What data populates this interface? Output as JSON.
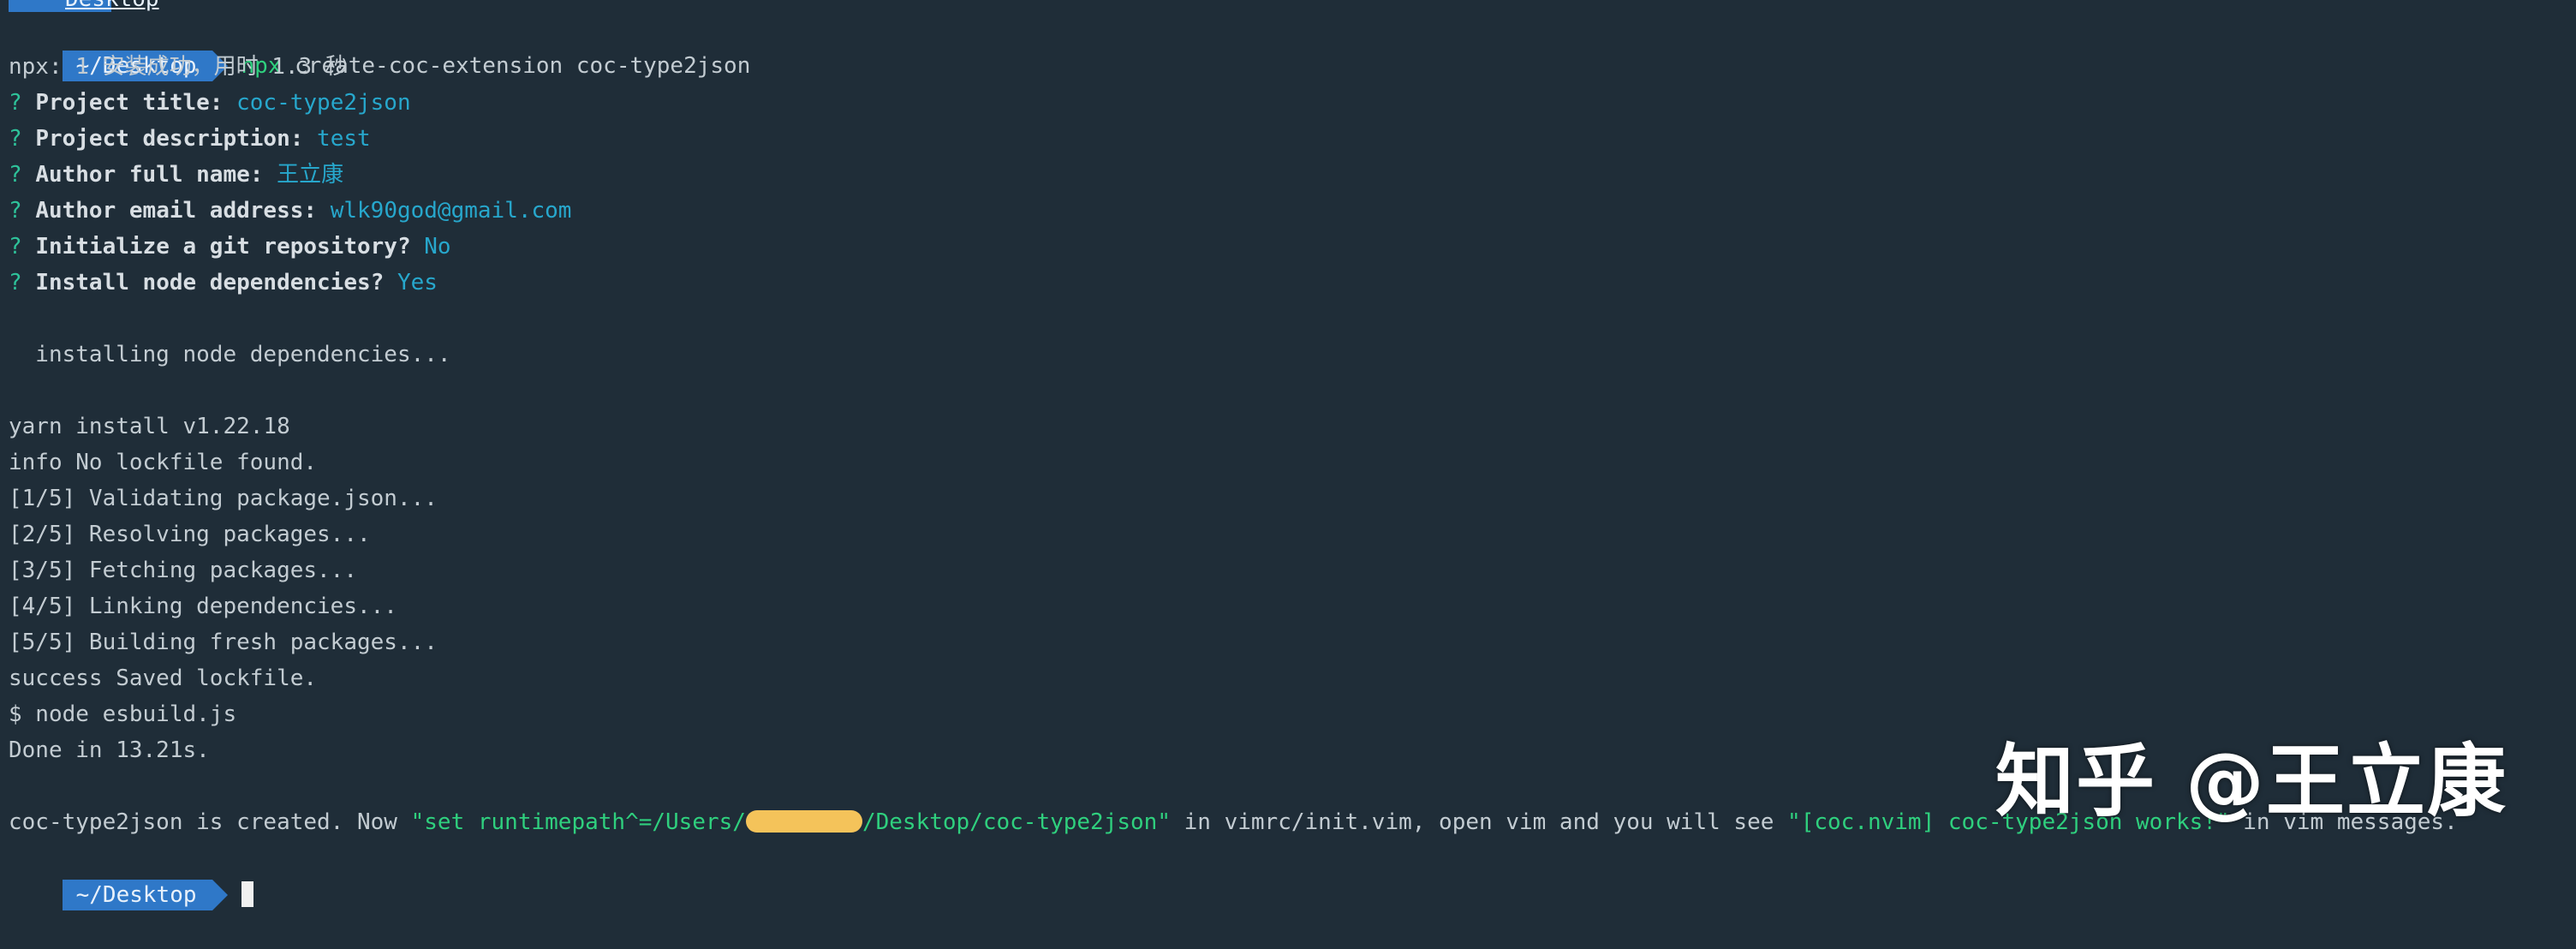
{
  "colors": {
    "background": "#1f2d38",
    "prompt_bg": "#2f78c8",
    "command": "#2fd07e",
    "question_mark": "#2ec29a",
    "answer": "#27a7cc",
    "redaction": "#f4c35a"
  },
  "top_fragment": "Desktop",
  "prompt": {
    "path": "~/Desktop"
  },
  "command": {
    "exe": "npx",
    "args": " create-coc-extension coc-type2json"
  },
  "npx_note": "npx: 1 安装成功，用时 1.3 秒",
  "questions": [
    {
      "mark": "?",
      "label": "Project title:",
      "answer": "coc-type2json"
    },
    {
      "mark": "?",
      "label": "Project description:",
      "answer": "test"
    },
    {
      "mark": "?",
      "label": "Author full name:",
      "answer": "王立康"
    },
    {
      "mark": "?",
      "label": "Author email address:",
      "answer": "wlk90god@gmail.com"
    },
    {
      "mark": "?",
      "label": "Initialize a git repository?",
      "answer": "No"
    },
    {
      "mark": "?",
      "label": "Install node dependencies?",
      "answer": "Yes"
    }
  ],
  "installing": "  installing node dependencies...",
  "yarn": [
    "yarn install v1.22.18",
    "info No lockfile found.",
    "[1/5] Validating package.json...",
    "[2/5] Resolving packages...",
    "[3/5] Fetching packages...",
    "[4/5] Linking dependencies...",
    "[5/5] Building fresh packages...",
    "success Saved lockfile.",
    "$ node esbuild.js",
    "Done in 13.21s."
  ],
  "final": {
    "part1": "coc-type2json is created. Now ",
    "str1_a": "\"set runtimepath^=/Users/",
    "str1_b": "/Desktop/coc-type2json\"",
    "part2": " in vimrc/init.vim, open vim and you will see ",
    "str2": "\"[coc.nvim] coc-type2json works!\"",
    "part3": " in vim messages."
  },
  "watermark": "知乎 @王立康"
}
